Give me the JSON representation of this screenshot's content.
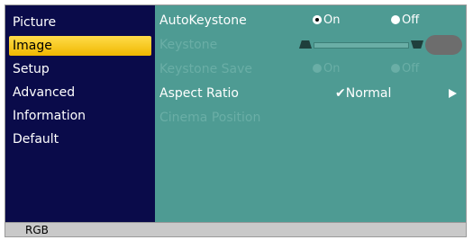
{
  "menu": {
    "items": [
      {
        "label": "Picture",
        "selected": false
      },
      {
        "label": "Image",
        "selected": true
      },
      {
        "label": "Setup",
        "selected": false
      },
      {
        "label": "Advanced",
        "selected": false
      },
      {
        "label": "Information",
        "selected": false
      },
      {
        "label": "Default",
        "selected": false
      }
    ]
  },
  "content": {
    "auto_keystone": {
      "label": "AutoKeystone",
      "on_label": "On",
      "off_label": "Off",
      "value": "On"
    },
    "keystone": {
      "label": "Keystone"
    },
    "keystone_save": {
      "label": "Keystone Save",
      "on_label": "On",
      "off_label": "Off"
    },
    "aspect_ratio": {
      "label": "Aspect Ratio",
      "value": "✔Normal"
    },
    "cinema_position": {
      "label": "Cinema Position"
    }
  },
  "status": {
    "source": "RGB"
  },
  "colors": {
    "menu_bg": "#0a0b4a",
    "selected_bg": "#f0b800",
    "content_bg": "#4e9b93",
    "disabled_text": "#6aaea6",
    "status_bg": "#c9c9c9"
  }
}
